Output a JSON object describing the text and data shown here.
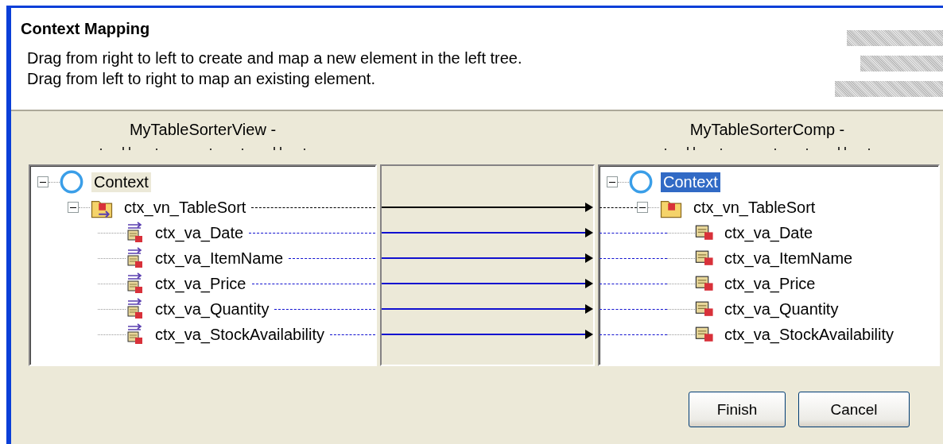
{
  "dialog": {
    "title": "Context Mapping",
    "description": [
      "Drag from right to left to create and map a new element in the left tree.",
      "Drag from left to right to map an existing element."
    ]
  },
  "left_tree": {
    "heading": "MyTableSorterView -",
    "focused": false,
    "items": [
      {
        "label": "Context",
        "kind": "context",
        "selected": true,
        "expanded": true,
        "children": [
          {
            "label": "ctx_vn_TableSort",
            "kind": "node",
            "mapped": true,
            "expanded": true,
            "children": [
              {
                "label": "ctx_va_Date",
                "kind": "attribute",
                "mapped": true
              },
              {
                "label": "ctx_va_ItemName",
                "kind": "attribute",
                "mapped": true
              },
              {
                "label": "ctx_va_Price",
                "kind": "attribute",
                "mapped": true
              },
              {
                "label": "ctx_va_Quantity",
                "kind": "attribute",
                "mapped": true
              },
              {
                "label": "ctx_va_StockAvailability",
                "kind": "attribute",
                "mapped": true
              }
            ]
          }
        ]
      }
    ]
  },
  "right_tree": {
    "heading": "MyTableSorterComp -",
    "focused": true,
    "items": [
      {
        "label": "Context",
        "kind": "context",
        "selected": true,
        "expanded": true,
        "children": [
          {
            "label": "ctx_vn_TableSort",
            "kind": "node",
            "mapped": true,
            "expanded": true,
            "children": [
              {
                "label": "ctx_va_Date",
                "kind": "attribute",
                "mapped": true
              },
              {
                "label": "ctx_va_ItemName",
                "kind": "attribute",
                "mapped": true
              },
              {
                "label": "ctx_va_Price",
                "kind": "attribute",
                "mapped": true
              },
              {
                "label": "ctx_va_Quantity",
                "kind": "attribute",
                "mapped": true
              },
              {
                "label": "ctx_va_StockAvailability",
                "kind": "attribute",
                "mapped": true
              }
            ]
          }
        ]
      }
    ]
  },
  "buttons": [
    "Finish",
    "Cancel"
  ]
}
